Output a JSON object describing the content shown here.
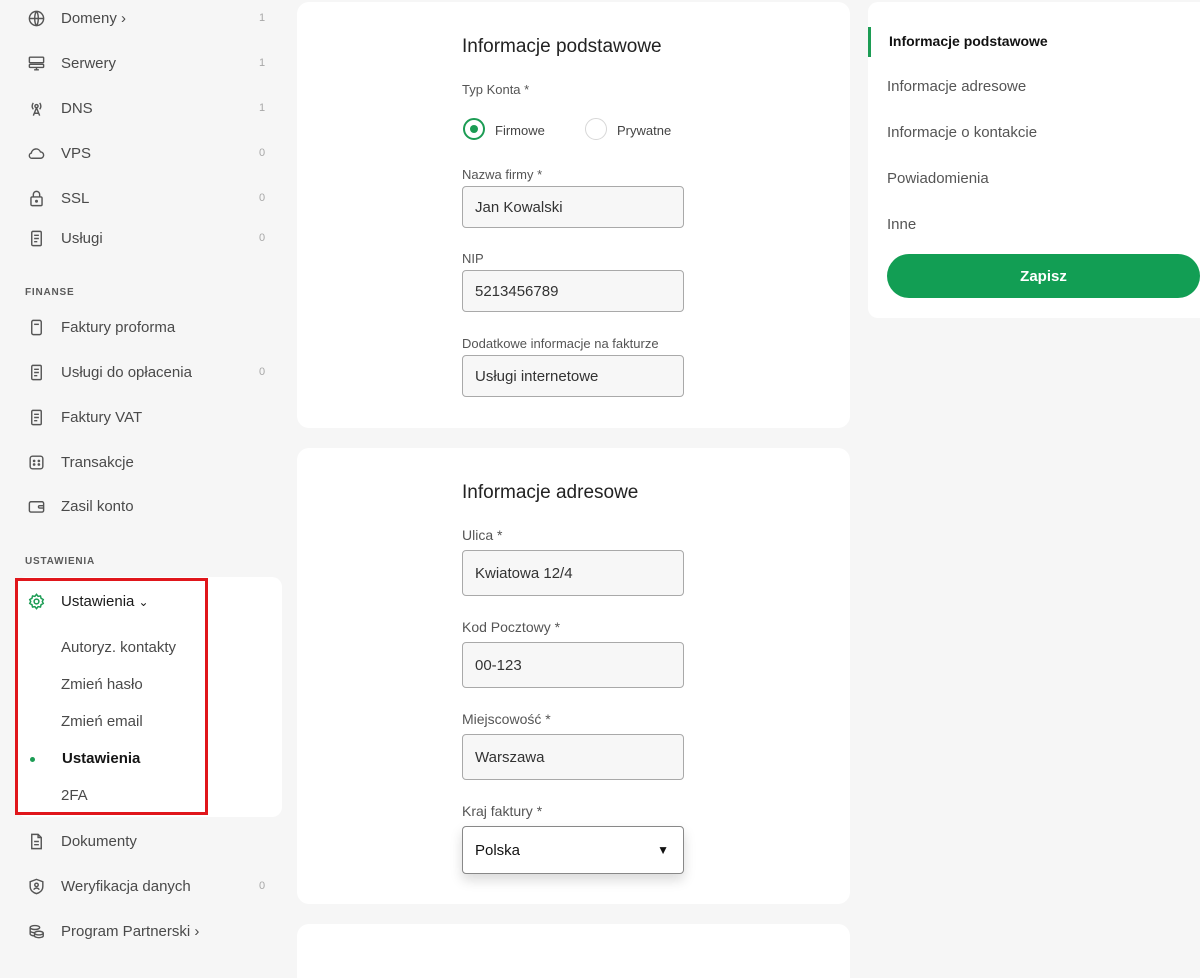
{
  "sidebar": {
    "items_top": [
      {
        "label": "Domeny ›",
        "count": "1",
        "icon": "globe-icon"
      },
      {
        "label": "Serwery",
        "count": "1",
        "icon": "server-icon"
      },
      {
        "label": "DNS",
        "count": "1",
        "icon": "antenna-icon"
      },
      {
        "label": "VPS",
        "count": "0",
        "icon": "cloud-icon"
      },
      {
        "label": "SSL",
        "count": "0",
        "icon": "lock-icon"
      },
      {
        "label": "Usługi",
        "count": "0",
        "icon": "document-icon"
      }
    ],
    "finance_title": "FINANSE",
    "finance_items": [
      {
        "label": "Faktury proforma",
        "count": "",
        "icon": "invoice-icon"
      },
      {
        "label": "Usługi do opłacenia",
        "count": "0",
        "icon": "document-icon"
      },
      {
        "label": "Faktury VAT",
        "count": "",
        "icon": "document-icon"
      },
      {
        "label": "Transakcje",
        "count": "",
        "icon": "transactions-icon"
      },
      {
        "label": "Zasil konto",
        "count": "",
        "icon": "wallet-icon"
      }
    ],
    "settings_title": "USTAWIENIA",
    "settings_group": {
      "label": "Ustawienia",
      "caret": "⌄",
      "sub_items": [
        "Autoryz. kontakty",
        "Zmień hasło",
        "Zmień email",
        "Ustawienia",
        "2FA"
      ],
      "active_sub": "Ustawienia"
    },
    "items_bottom": [
      {
        "label": "Dokumenty",
        "count": "",
        "icon": "file-icon"
      },
      {
        "label": "Weryfikacja danych",
        "count": "0",
        "icon": "shield-user-icon"
      },
      {
        "label": "Program Partnerski ›",
        "count": "",
        "icon": "coins-icon"
      }
    ]
  },
  "basic_info": {
    "title": "Informacje podstawowe",
    "account_type_label": "Typ Konta *",
    "account_options": [
      "Firmowe",
      "Prywatne"
    ],
    "account_selected": "Firmowe",
    "company_name_label": "Nazwa firmy *",
    "company_name_value": "Jan Kowalski",
    "nip_label": "NIP",
    "nip_value": "5213456789",
    "invoice_info_label": "Dodatkowe informacje na fakturze",
    "invoice_info_value": "Usługi internetowe"
  },
  "address_info": {
    "title": "Informacje adresowe",
    "street_label": "Ulica *",
    "street_value": "Kwiatowa 12/4",
    "postal_label": "Kod Pocztowy *",
    "postal_value": "00-123",
    "city_label": "Miejscowość *",
    "city_value": "Warszawa",
    "country_label": "Kraj faktury *",
    "country_value": "Polska",
    "country_caret": "▼"
  },
  "right_nav": {
    "items": [
      "Informacje podstawowe",
      "Informacje adresowe",
      "Informacje o kontakcie",
      "Powiadomienia",
      "Inne"
    ],
    "active": "Informacje podstawowe",
    "save_label": "Zapisz"
  },
  "colors": {
    "accent": "#129e54",
    "highlight_border": "#e0161b",
    "background": "#f6f6f6"
  }
}
